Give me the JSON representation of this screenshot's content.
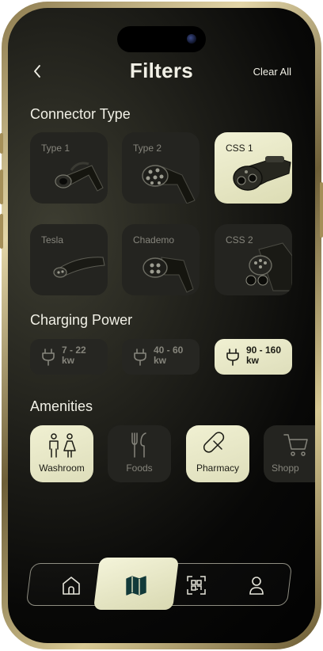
{
  "header": {
    "title": "Filters",
    "clear_all_label": "Clear All"
  },
  "connector_type": {
    "title": "Connector Type",
    "items": [
      {
        "label": "Type 1",
        "selected": false
      },
      {
        "label": "Type 2",
        "selected": false
      },
      {
        "label": "CSS 1",
        "selected": true
      },
      {
        "label": "Tesla",
        "selected": false
      },
      {
        "label": "Chademo",
        "selected": false
      },
      {
        "label": "CSS 2",
        "selected": false
      }
    ]
  },
  "charging_power": {
    "title": "Charging Power",
    "options": [
      {
        "range": "7 - 22",
        "unit": "kw",
        "selected": false
      },
      {
        "range": "40 - 60",
        "unit": "kw",
        "selected": false
      },
      {
        "range": "90 - 160",
        "unit": "kw",
        "selected": true
      }
    ]
  },
  "amenities": {
    "title": "Amenities",
    "items": [
      {
        "label": "Washroom",
        "icon": "washroom-icon",
        "selected": true
      },
      {
        "label": "Foods",
        "icon": "fork-knife-icon",
        "selected": false
      },
      {
        "label": "Pharmacy",
        "icon": "pill-icon",
        "selected": true
      },
      {
        "label": "Shopp",
        "icon": "shopping-cart-icon",
        "selected": false
      }
    ]
  },
  "tab_bar": {
    "items": [
      {
        "icon": "home-icon",
        "active": false
      },
      {
        "icon": "map-icon",
        "active": true
      },
      {
        "icon": "qr-scan-icon",
        "active": false
      },
      {
        "icon": "profile-icon",
        "active": false
      }
    ]
  },
  "colors": {
    "accent": "#e8e8c4",
    "card_bg": "#242420",
    "background": "#0a0a08",
    "text_primary": "#f1f0e6",
    "text_muted": "#86857c",
    "frame_gold": "#c9b77e"
  }
}
